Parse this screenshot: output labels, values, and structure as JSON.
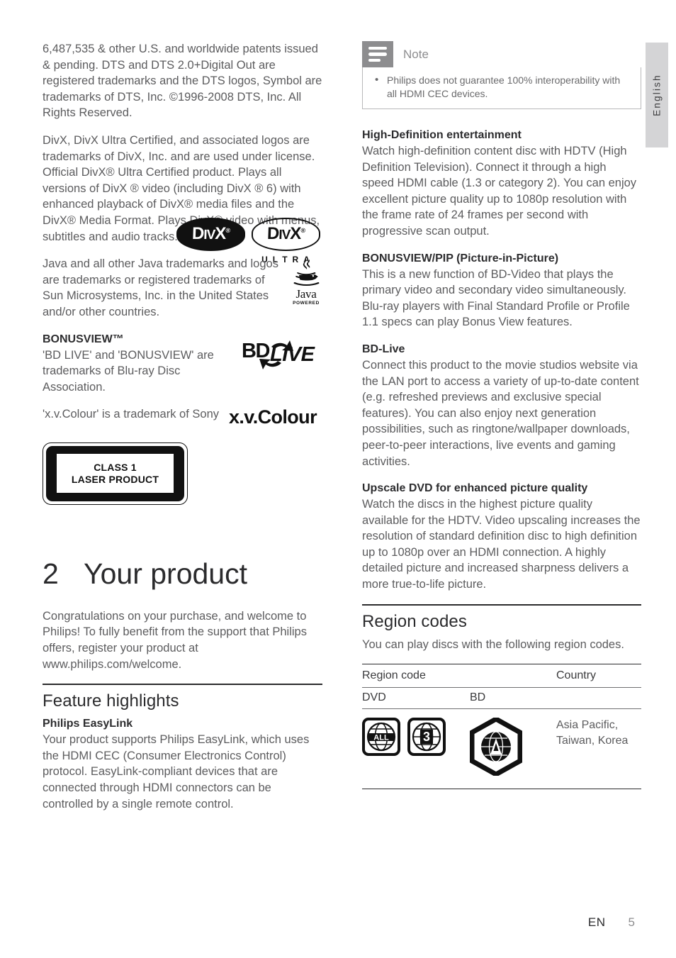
{
  "language_tab": {
    "label": "English"
  },
  "footer": {
    "lang_code": "EN",
    "page_number": "5"
  },
  "left_column": {
    "patents_paragraph": "6,487,535 & other U.S. and worldwide patents issued & pending. DTS and DTS 2.0+Digital Out are registered trademarks and the DTS logos, Symbol are trademarks of DTS, Inc. ©1996-2008 DTS, Inc. All Rights Reserved.",
    "divx_paragraph": "DivX, DivX Ultra Certified, and associated logos are trademarks of DivX, Inc. and are used under license. Official DivX® Ultra Certified product. Plays all versions of DivX ® video (including DivX ® 6) with enhanced playback of DivX® media files and the DivX® Media Format. Plays DivX® video with menus, subtitles and audio tracks.",
    "java_paragraph": "Java and all other Java trademarks and logos are trademarks or registered trademarks of Sun Microsystems, Inc. in the United States and/or other countries.",
    "bonusview_heading": "BONUSVIEW™",
    "bonusview_paragraph": "'BD LIVE' and 'BONUSVIEW' are trademarks of Blu-ray Disc Association.",
    "xvcolour_paragraph": "'x.v.Colour' is a trademark of Sony",
    "logos": {
      "divx_word": "DivX",
      "divx_reg": "®",
      "divx_ultra_word": "ULTRA",
      "java_word": "Java",
      "java_powered": "POWERED",
      "bdlive_bd": "BD",
      "bdlive_live": "LIVE",
      "xvcolour": "x.v.Colour"
    },
    "laser_label": {
      "line1": "CLASS 1",
      "line2": "LASER PRODUCT"
    },
    "chapter": {
      "number": "2",
      "title": "Your product"
    },
    "intro_paragraph": "Congratulations on your purchase, and welcome to Philips! To fully benefit from the support that Philips offers, register your product at www.philips.com/welcome.",
    "feature_highlights_heading": "Feature highlights",
    "easylink_heading": "Philips EasyLink",
    "easylink_paragraph": "Your product supports Philips EasyLink, which uses the HDMI CEC (Consumer Electronics Control) protocol. EasyLink-compliant devices that are connected through HDMI connectors can be controlled by a single remote control."
  },
  "right_column": {
    "note": {
      "title": "Note",
      "icon": "note-lines-icon",
      "items": [
        "Philips does not guarantee 100% interoperability with all HDMI CEC devices."
      ]
    },
    "sections": [
      {
        "heading": "High-Definition entertainment",
        "body": "Watch high-definition content disc with HDTV (High Definition Television). Connect it through a high speed HDMI cable (1.3 or category 2). You can enjoy excellent picture quality up to 1080p resolution with the frame rate of 24 frames per second with progressive scan output."
      },
      {
        "heading": "BONUSVIEW/PIP (Picture-in-Picture)",
        "body": "This is a new function of BD-Video that plays the primary video and secondary video simultaneously. Blu-ray players with Final Standard Profile or Profile 1.1 specs can play Bonus View features."
      },
      {
        "heading": "BD-Live",
        "body": "Connect this product to the movie studios website via the LAN port to access a variety of up-to-date content (e.g. refreshed previews and exclusive special features). You can also enjoy next generation possibilities, such as ringtone/wallpaper downloads, peer-to-peer interactions, live events and gaming activities."
      },
      {
        "heading": "Upscale DVD for enhanced picture quality",
        "body": "Watch the discs in the highest picture quality available for the HDTV. Video upscaling increases the resolution of standard definition disc to high definition up to 1080p over an HDMI connection. A highly detailed picture and increased sharpness delivers a more true-to-life picture."
      }
    ],
    "region_codes": {
      "heading": "Region codes",
      "intro": "You can play discs with the following region codes.",
      "table": {
        "header": {
          "region_code": "Region code",
          "country": "Country"
        },
        "subheader": {
          "dvd": "DVD",
          "bd": "BD"
        },
        "row": {
          "dvd_badges": [
            "ALL",
            "3"
          ],
          "bd_badge": "A",
          "country": "Asia Pacific, Taiwan, Korea"
        }
      }
    }
  }
}
